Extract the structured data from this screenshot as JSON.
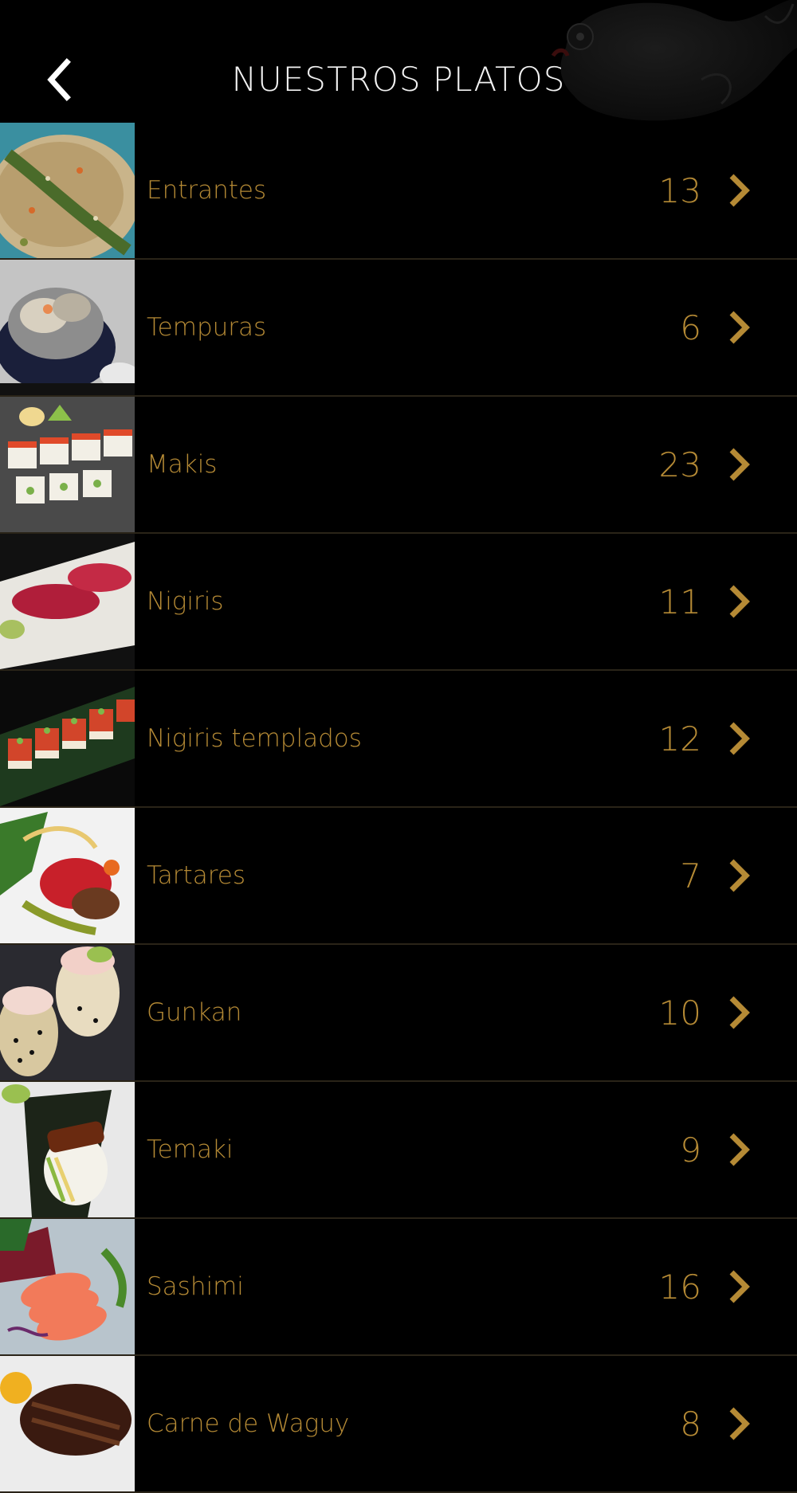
{
  "header": {
    "title": "NUESTROS PLATOS",
    "back_icon": "chevron-left-icon"
  },
  "colors": {
    "background": "#000000",
    "accent_gold": "#b58a35",
    "title": "#f2f2f2",
    "divider": "#2a2418"
  },
  "categories": [
    {
      "label": "Entrantes",
      "count": "13",
      "icon": "chevron-right-icon"
    },
    {
      "label": "Tempuras",
      "count": "6",
      "icon": "chevron-right-icon"
    },
    {
      "label": "Makis",
      "count": "23",
      "icon": "chevron-right-icon"
    },
    {
      "label": "Nigiris",
      "count": "11",
      "icon": "chevron-right-icon"
    },
    {
      "label": "Nigiris templados",
      "count": "12",
      "icon": "chevron-right-icon"
    },
    {
      "label": "Tartares",
      "count": "7",
      "icon": "chevron-right-icon"
    },
    {
      "label": "Gunkan",
      "count": "10",
      "icon": "chevron-right-icon"
    },
    {
      "label": "Temaki",
      "count": "9",
      "icon": "chevron-right-icon"
    },
    {
      "label": "Sashimi",
      "count": "16",
      "icon": "chevron-right-icon"
    },
    {
      "label": "Carne de Waguy",
      "count": "8",
      "icon": "chevron-right-icon"
    }
  ]
}
